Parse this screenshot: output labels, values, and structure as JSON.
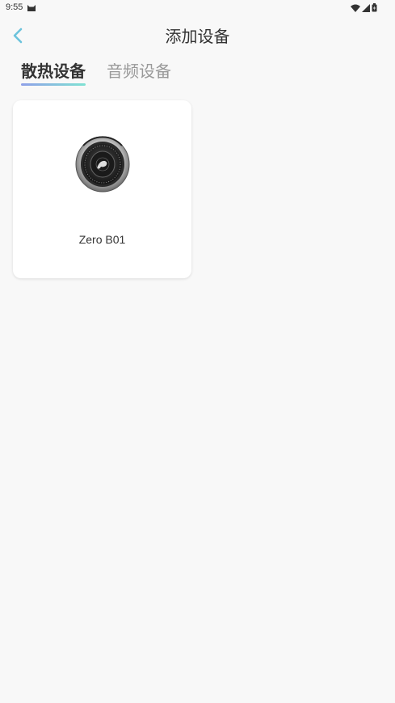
{
  "status_bar": {
    "time": "9:55"
  },
  "header": {
    "title": "添加设备"
  },
  "tabs": [
    {
      "label": "散热设备",
      "active": true
    },
    {
      "label": "音频设备",
      "active": false
    }
  ],
  "devices": [
    {
      "name": "Zero B01"
    }
  ],
  "colors": {
    "accent": "#6cc3dc",
    "tab_underline_start": "#8fa0e8",
    "tab_underline_end": "#7fe2d3",
    "background": "#f8f8f8"
  }
}
